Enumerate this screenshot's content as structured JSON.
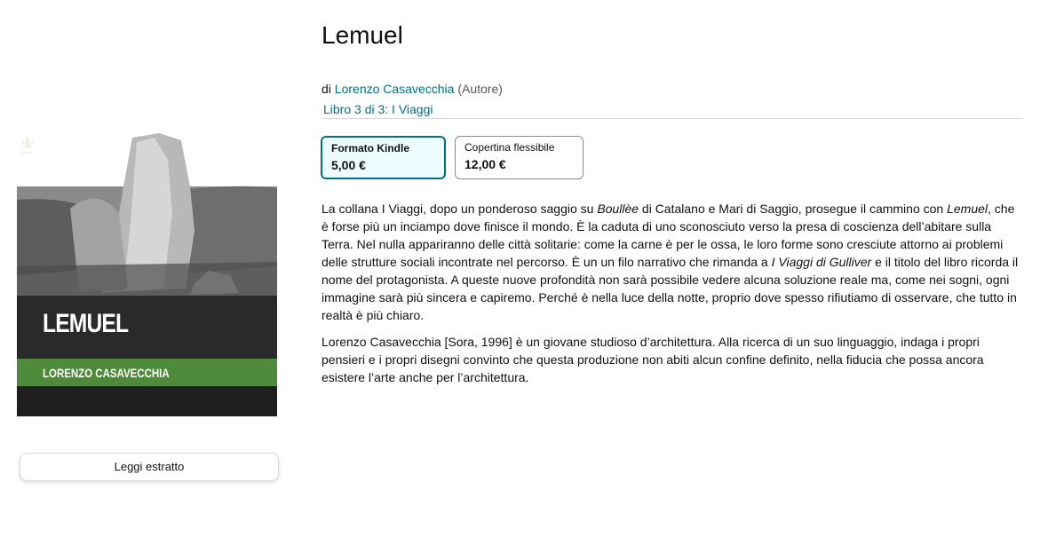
{
  "product": {
    "title": "Lemuel",
    "by_prefix": "di",
    "author": "Lorenzo Casavecchia",
    "author_role": "(Autore)",
    "series": "Libro 3 di 3: I Viaggi"
  },
  "cover": {
    "title": "LEMUEL",
    "author": "LORENZO CASAVECCHIA",
    "green": "#4f8a3a"
  },
  "formats": [
    {
      "label": "Formato Kindle",
      "price": "5,00 €",
      "selected": true
    },
    {
      "label": "Copertina flessibile",
      "price": "12,00 €",
      "selected": false
    }
  ],
  "description": {
    "p1": [
      "La collana I Viaggi, dopo un ponderoso saggio su ",
      "Boullèe",
      " di Catalano e Mari di Saggio, prosegue il cammino con ",
      "Lemuel",
      ", che è forse più un inciampo dove finisce il mondo. È la caduta di uno sconosciuto verso la presa di coscienza dell’abitare sulla Terra. Nel nulla appariranno delle città solitarie: come la carne è per le ossa, le loro forme sono cresciute attorno ai problemi delle strutture sociali incontrate nel percorso. È un un filo narrativo che rimanda a ",
      "I Viaggi di Gulliver",
      " e il titolo del libro ricorda il nome del protagonista. A queste nuove profondità non sarà possibile vedere alcuna soluzione reale ma, come nei sogni, ogni immagine sarà più sincera e capiremo. Perché è nella luce della notte, proprio dove spesso rifiutiamo di osservare, che tutto in realtà è più chiaro."
    ],
    "p2": "Lorenzo Casavecchia [Sora, 1996] è un giovane studioso d’architettura. Alla ricerca di un suo linguaggio, indaga i propri pensieri e i propri disegni convinto che questa produzione non abiti alcun confine definito, nella fiducia che possa ancora esistere l’arte anche per l’architettura."
  },
  "actions": {
    "read_sample": "Leggi estratto"
  }
}
